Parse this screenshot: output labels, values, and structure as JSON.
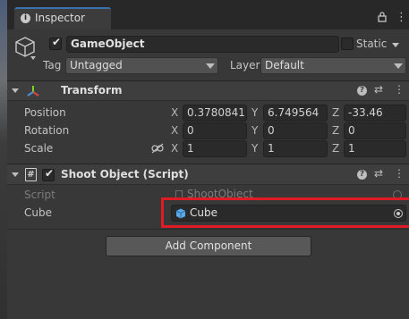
{
  "tab": {
    "title": "Inspector",
    "icon": "info-icon"
  },
  "tab_controls": {
    "lock_icon": "lock-icon",
    "menu_icon": "kebab-menu-icon"
  },
  "gameobject": {
    "name": "GameObject",
    "static_label": "Static",
    "tag_label": "Tag",
    "tag_value": "Untagged",
    "layer_label": "Layer",
    "layer_value": "Default",
    "icon": "cube-outline-icon"
  },
  "transform": {
    "title": "Transform",
    "rows": [
      {
        "label": "Position",
        "x": "0.3780841",
        "y": "6.749564",
        "z": "-33.46"
      },
      {
        "label": "Rotation",
        "x": "0",
        "y": "0",
        "z": "0"
      },
      {
        "label": "Scale",
        "x": "1",
        "y": "1",
        "z": "1"
      }
    ],
    "axes": {
      "x": "X",
      "y": "Y",
      "z": "Z"
    }
  },
  "script_component": {
    "title": "Shoot Object (Script)",
    "script_label": "Script",
    "script_value": "ShootObject",
    "cube_label": "Cube",
    "cube_value": "Cube"
  },
  "add_component_label": "Add Component",
  "colors": {
    "accent": "#3a72b0",
    "highlight": "#e01b24",
    "background": "#383838"
  }
}
